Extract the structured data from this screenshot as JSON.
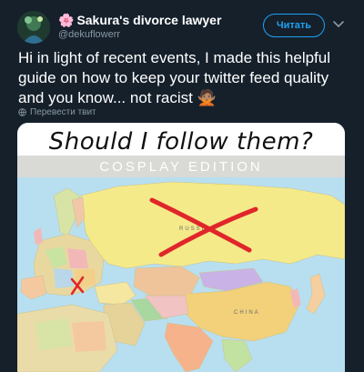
{
  "author": {
    "display_name": "Sakura's divorce lawyer",
    "name_emoji": "🌸",
    "handle": "@dekuflowerr"
  },
  "follow_button": {
    "label": "Читать"
  },
  "tweet": {
    "text": "Hi in light of recent events, I made this helpful guide on how to keep your twitter feed quality and you know... not racist 🙅🏽",
    "translate_label": "Перевести твит"
  },
  "media": {
    "title": "Should I follow them?",
    "subtitle": "COSPLAY EDITION",
    "map_labels": {
      "russia": "RUSSIA",
      "china": "CHINA"
    }
  },
  "icons": {
    "avatar": "avatar-image",
    "caret": "chevron-down-icon",
    "translate": "globe-icon"
  },
  "colors": {
    "background": "#15202b",
    "accent": "#1da1f2",
    "secondary_text": "#8899a6",
    "cross_mark": "#e0262a"
  }
}
